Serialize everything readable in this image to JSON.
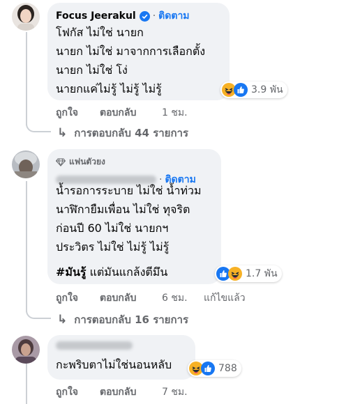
{
  "comments": [
    {
      "author": "Focus Jeerakul",
      "verified": true,
      "follow_label": "ติดตาม",
      "lines": [
        "โฟกัส ไม่ใช่ นายก",
        "นายก ไม่ใช่ มาจากการเลือกตั้ง",
        "นายก ไม่ใช่ โง่",
        "นายกแค่ไม่รู้ ไม่รู้ ไม่รู้"
      ],
      "reaction_count": "3.9 พัน",
      "reaction_icons": [
        "haha-icon",
        "like-icon"
      ],
      "like_label": "ถูกใจ",
      "reply_label": "ตอบกลับ",
      "time": "1 ชม.",
      "replies_label": "การตอบกลับ 44 รายการ"
    },
    {
      "badge": "แฟนตัวยง",
      "follow_label": "ติดตาม",
      "lines": [
        "น้ำรอการระบาย ไม่ใช่ น้ำท่วม",
        "นาฬิกายืมเพื่อน ไม่ใช่ ทุจริต",
        "ก่อนปี 60 ไม่ใช่ นายกฯ",
        "ประวิตร ไม่ใช่ ไม่รู้ ไม่รู้"
      ],
      "hashtag": "#มันรู้",
      "hashtag_rest": " แต่มันแกล้งตีมึน",
      "reaction_count": "1.7 พัน",
      "reaction_icons": [
        "like-icon",
        "haha-icon"
      ],
      "like_label": "ถูกใจ",
      "reply_label": "ตอบกลับ",
      "time": "6 ชม.",
      "edited_label": "แก้ไขแล้ว",
      "replies_label": "การตอบกลับ 16 รายการ"
    },
    {
      "lines": [
        "กะพริบตาไม่ใช่นอนหลับ"
      ],
      "reaction_count": "788",
      "reaction_icons": [
        "haha-icon",
        "like-icon"
      ],
      "like_label": "ถูกใจ",
      "reply_label": "ตอบกลับ",
      "time": "7 ชม."
    }
  ],
  "colors": {
    "bubble": "#f0f2f5",
    "link_blue": "#1877f2",
    "secondary_text": "#65676b",
    "haha_yellow": "#f7b125",
    "like_blue": "#1877f2"
  }
}
